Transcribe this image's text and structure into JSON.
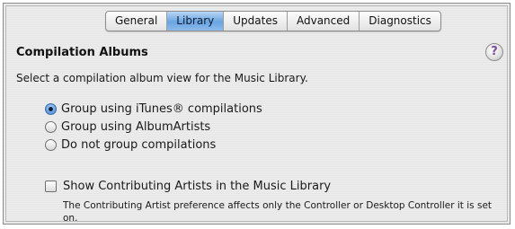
{
  "tabs": [
    {
      "label": "General",
      "active": false
    },
    {
      "label": "Library",
      "active": true
    },
    {
      "label": "Updates",
      "active": false
    },
    {
      "label": "Advanced",
      "active": false
    },
    {
      "label": "Diagnostics",
      "active": false
    }
  ],
  "section": {
    "title": "Compilation Albums",
    "help_label": "?",
    "description": "Select a compilation album view for the Music Library."
  },
  "options": [
    {
      "label": "Group using iTunes® compilations",
      "selected": true
    },
    {
      "label": "Group using AlbumArtists",
      "selected": false
    },
    {
      "label": "Do not group compilations",
      "selected": false
    }
  ],
  "contributing": {
    "label": "Show Contributing Artists in the Music Library",
    "checked": false,
    "note": "The Contributing Artist preference affects only the Controller or Desktop Controller it is set on."
  },
  "colors": {
    "active_tab": "#6aa4e0",
    "help_icon": "#7b4b9c"
  }
}
